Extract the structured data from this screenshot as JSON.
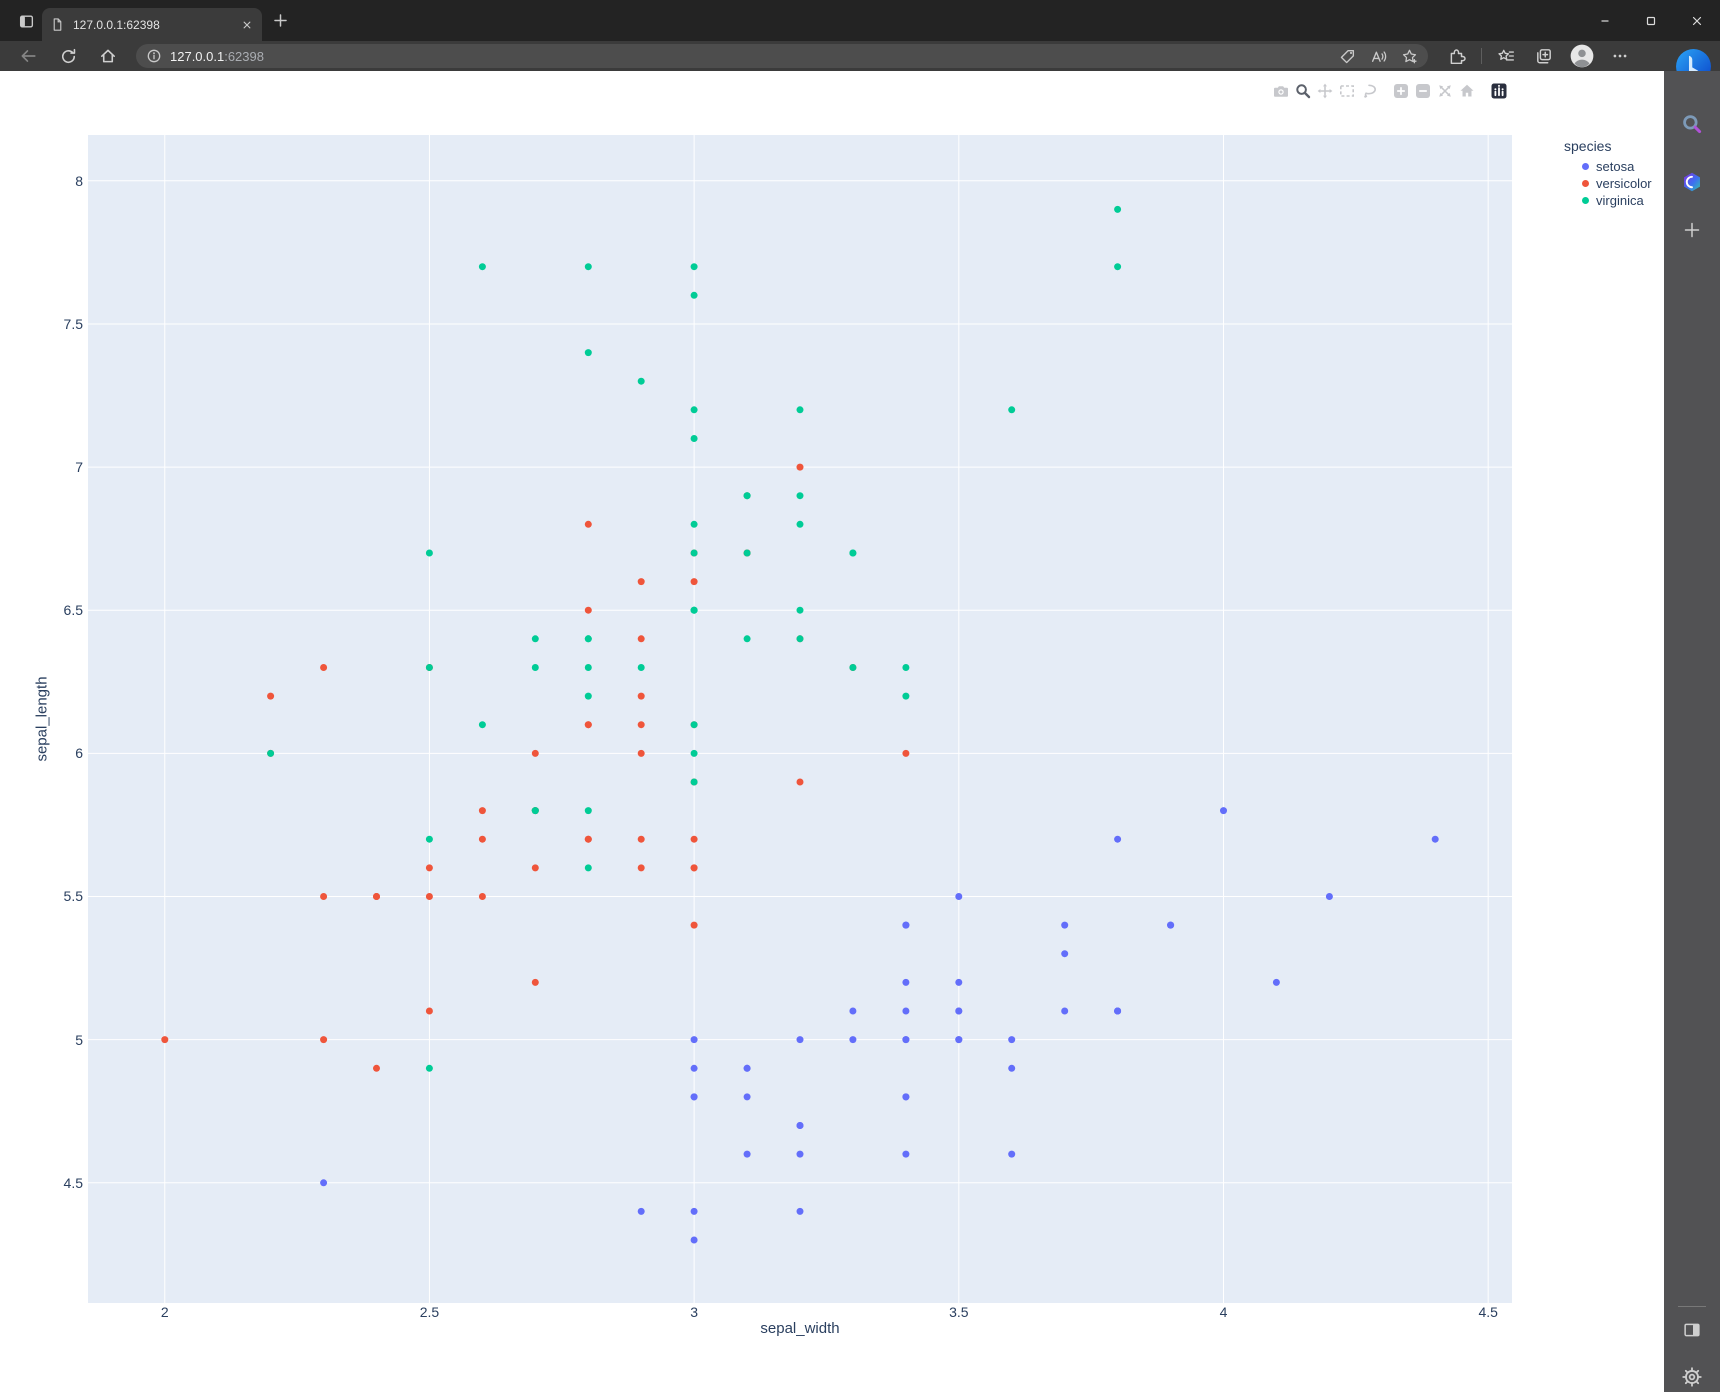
{
  "browser": {
    "tab_title": "127.0.0.1:62398",
    "url_host": "127.0.0.1",
    "url_port": ":62398",
    "window_controls": [
      "minimize",
      "maximize",
      "close"
    ],
    "nav_icons": [
      "back",
      "refresh",
      "home"
    ],
    "pill_icons": [
      "shopping",
      "read-aloud",
      "favorite-add"
    ],
    "right_icons": [
      "extensions",
      "divider",
      "favorites",
      "collections",
      "profile",
      "more"
    ]
  },
  "sidebar": {
    "top_icons": [
      "search",
      "microsoft-365",
      "add"
    ],
    "bottom_icons": [
      "sidebar-panel",
      "settings"
    ]
  },
  "modebar": {
    "buttons": [
      "camera",
      "zoom",
      "pan",
      "box-select",
      "lasso",
      "zoom-in",
      "zoom-out",
      "autoscale",
      "reset-home",
      "plotly-logo"
    ],
    "active_button": "zoom"
  },
  "chart_data": {
    "type": "scatter",
    "title": "",
    "xlabel": "sepal_width",
    "ylabel": "sepal_length",
    "legend_title": "species",
    "x_range": [
      1.855,
      4.545
    ],
    "y_range": [
      4.08,
      8.16
    ],
    "x_ticks": [
      2,
      2.5,
      3,
      3.5,
      4,
      4.5
    ],
    "y_ticks": [
      4.5,
      5,
      5.5,
      6,
      6.5,
      7,
      7.5,
      8
    ],
    "plot_bg": "#e5ecf6",
    "grid_color": "#ffffff",
    "text_color": "#2a3f5f",
    "marker_diameter": 7,
    "legend_position": "top-right-outside",
    "grid": true,
    "series": [
      {
        "name": "setosa",
        "color": "#636efa",
        "x": [
          3.5,
          3.0,
          3.2,
          3.1,
          3.6,
          3.9,
          3.4,
          3.4,
          2.9,
          3.1,
          3.7,
          3.4,
          3.0,
          3.0,
          4.0,
          4.4,
          3.9,
          3.5,
          3.8,
          3.8,
          3.4,
          3.7,
          3.6,
          3.3,
          3.4,
          3.0,
          3.4,
          3.5,
          3.4,
          3.2,
          3.1,
          3.4,
          4.1,
          4.2,
          3.1,
          3.2,
          3.5,
          3.6,
          3.0,
          3.4,
          3.5,
          2.3,
          3.2,
          3.5,
          3.8,
          3.0,
          3.8,
          3.2,
          3.7,
          3.3
        ],
        "y": [
          5.1,
          4.9,
          4.7,
          4.6,
          5.0,
          5.4,
          4.6,
          5.0,
          4.4,
          4.9,
          5.4,
          4.8,
          4.8,
          4.3,
          5.8,
          5.7,
          5.4,
          5.1,
          5.7,
          5.1,
          5.4,
          5.1,
          4.6,
          5.1,
          4.8,
          5.0,
          5.0,
          5.2,
          5.2,
          4.7,
          4.8,
          5.4,
          5.2,
          5.5,
          4.9,
          5.0,
          5.5,
          4.9,
          4.4,
          5.1,
          5.0,
          4.5,
          4.4,
          5.0,
          5.1,
          4.8,
          5.1,
          4.6,
          5.3,
          5.0
        ]
      },
      {
        "name": "versicolor",
        "color": "#ef553b",
        "x": [
          3.2,
          3.2,
          3.1,
          2.3,
          2.8,
          2.8,
          3.3,
          2.4,
          2.9,
          2.7,
          2.0,
          3.0,
          2.2,
          2.9,
          2.9,
          3.1,
          3.0,
          2.7,
          2.2,
          2.5,
          3.2,
          2.8,
          2.5,
          2.8,
          2.9,
          3.0,
          2.8,
          3.0,
          2.9,
          2.6,
          2.4,
          2.4,
          2.7,
          2.7,
          3.0,
          3.4,
          3.1,
          2.3,
          3.0,
          2.5,
          2.6,
          3.0,
          2.6,
          2.3,
          2.7,
          3.0,
          2.9,
          2.9,
          2.5,
          2.8
        ],
        "y": [
          7.0,
          6.4,
          6.9,
          5.5,
          6.5,
          5.7,
          6.3,
          4.9,
          6.6,
          5.2,
          5.0,
          5.9,
          6.0,
          6.1,
          5.6,
          6.7,
          5.6,
          5.8,
          6.2,
          5.6,
          5.9,
          6.1,
          6.3,
          6.1,
          6.4,
          6.6,
          6.8,
          6.7,
          6.0,
          5.7,
          5.5,
          5.5,
          5.8,
          6.0,
          5.4,
          6.0,
          6.7,
          6.3,
          5.6,
          5.5,
          5.5,
          6.1,
          5.8,
          5.0,
          5.6,
          5.7,
          5.7,
          6.2,
          5.1,
          5.7
        ]
      },
      {
        "name": "virginica",
        "color": "#00cc96",
        "x": [
          3.3,
          2.7,
          3.0,
          2.9,
          3.0,
          3.0,
          2.5,
          2.9,
          2.5,
          3.6,
          3.2,
          2.7,
          3.0,
          2.5,
          2.8,
          3.2,
          3.0,
          3.8,
          2.6,
          2.2,
          3.2,
          2.8,
          2.8,
          2.7,
          3.3,
          3.2,
          2.8,
          3.0,
          2.8,
          3.0,
          2.8,
          3.8,
          2.8,
          2.8,
          2.6,
          3.0,
          3.4,
          3.1,
          3.0,
          3.1,
          3.1,
          3.1,
          2.7,
          3.2,
          3.3,
          3.0,
          2.5,
          3.0,
          3.4,
          3.0
        ],
        "y": [
          6.3,
          5.8,
          7.1,
          6.3,
          6.5,
          7.6,
          4.9,
          7.3,
          6.7,
          7.2,
          6.5,
          6.4,
          6.8,
          5.7,
          5.8,
          6.4,
          6.5,
          7.7,
          7.7,
          6.0,
          6.9,
          5.6,
          7.7,
          6.3,
          6.7,
          7.2,
          6.2,
          6.1,
          6.4,
          7.2,
          7.4,
          7.9,
          6.4,
          6.3,
          6.1,
          7.7,
          6.3,
          6.4,
          6.0,
          6.9,
          6.7,
          6.9,
          5.8,
          6.8,
          6.7,
          6.7,
          6.3,
          6.5,
          6.2,
          5.9
        ]
      }
    ]
  }
}
